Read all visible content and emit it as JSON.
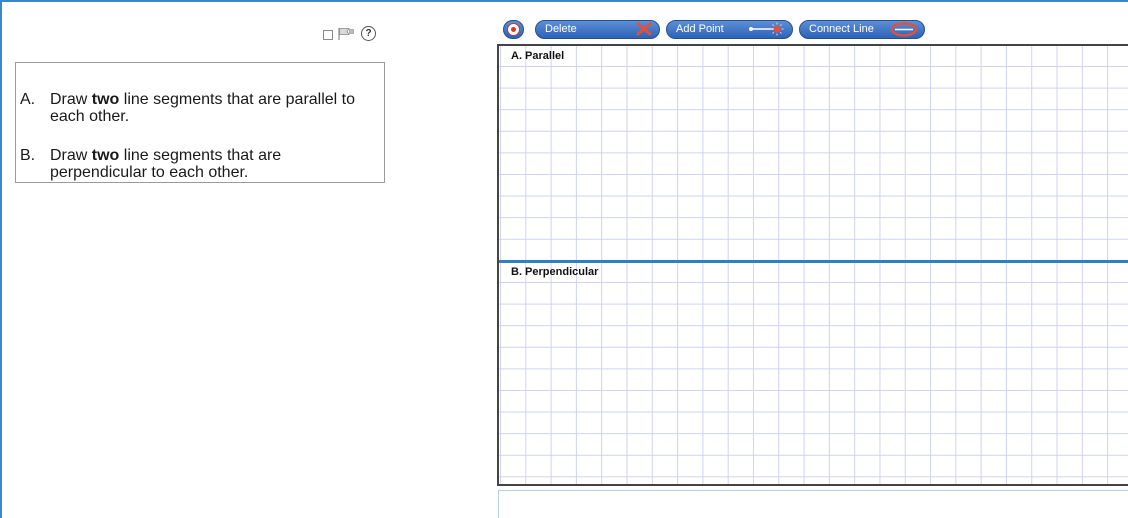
{
  "question": {
    "items": [
      {
        "letter": "A.",
        "before": "Draw ",
        "emphasis": "two",
        "after": " line segments that are parallel to each other."
      },
      {
        "letter": "B.",
        "before": "Draw ",
        "emphasis": "two",
        "after": " line segments that are perpendicular to each other."
      }
    ]
  },
  "question_tools": {
    "mark_icon": "checkbox-icon",
    "flag_icon": "flag-icon",
    "help_icon": "help-icon",
    "help_glyph": "?"
  },
  "toolbar": {
    "select_icon": "select-pointer-icon",
    "delete_label": "Delete",
    "delete_icon": "delete-x-icon",
    "add_point_label": "Add Point",
    "add_point_icon": "add-point-icon",
    "connect_line_label": "Connect Line",
    "connect_line_icon": "connect-line-icon"
  },
  "canvas": {
    "panels": [
      {
        "title": "A. Parallel"
      },
      {
        "title": "B. Perpendicular"
      }
    ]
  },
  "colors": {
    "accent": "#2f7fc1",
    "button": "#3a6fc4",
    "grid": "#cfd2f2",
    "delete_x": "#e0503a"
  }
}
